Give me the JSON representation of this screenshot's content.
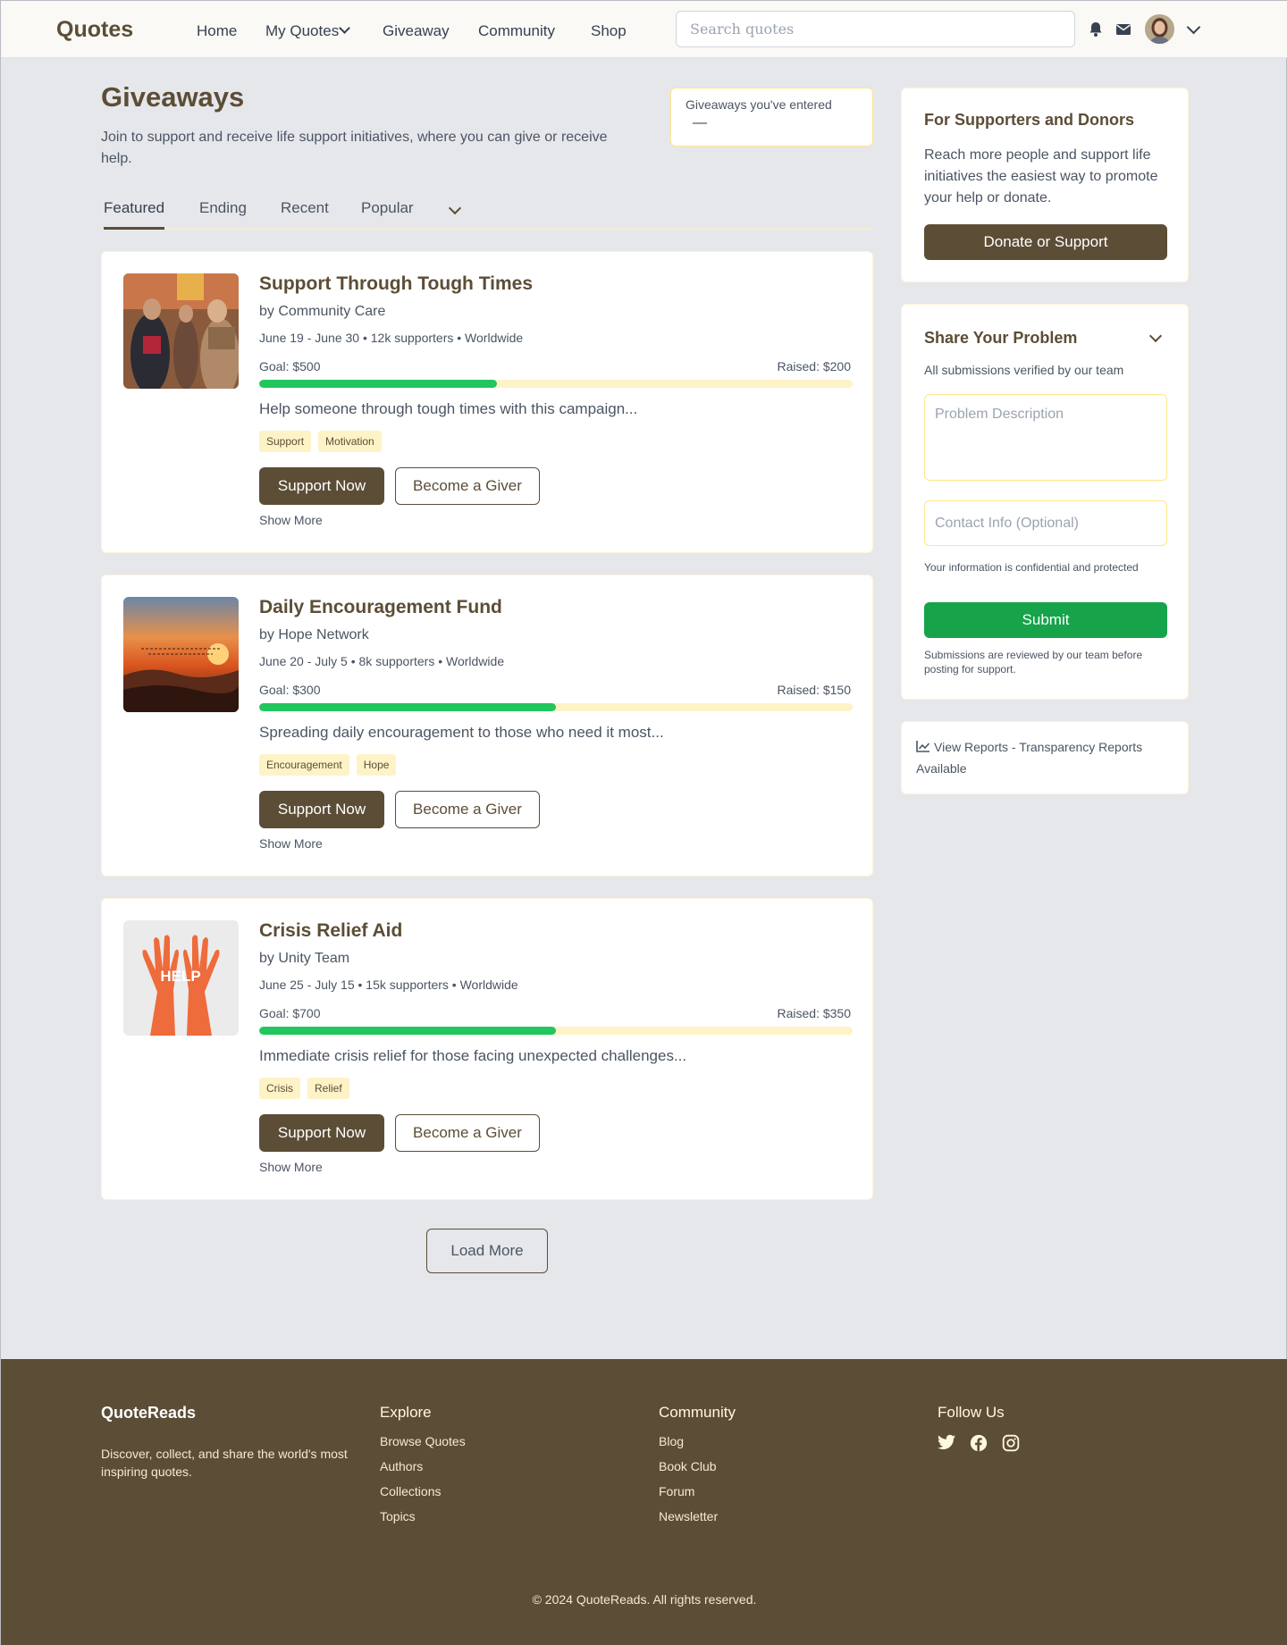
{
  "header": {
    "logo": "Quotes",
    "nav": [
      "Home",
      "My Quotes",
      "Giveaway",
      "Community",
      "Shop"
    ],
    "search_placeholder": "Search quotes"
  },
  "page": {
    "title": "Giveaways",
    "description": "Join to support and receive life support initiatives, where you can give or receive help.",
    "entered_label": "Giveaways you've entered",
    "entered_value": "—"
  },
  "tabs": [
    "Featured",
    "Ending",
    "Recent",
    "Popular"
  ],
  "cards": [
    {
      "title": "Support Through Tough Times",
      "by": "by Community Care",
      "meta": "June 19 - June 30 • 12k supporters • Worldwide",
      "goal": "Goal: $500",
      "raised": "Raised: $200",
      "progress": 0.4,
      "desc": "Help someone through tough times with this campaign...",
      "tags": [
        "Support",
        "Motivation"
      ],
      "support_label": "Support Now",
      "giver_label": "Become a Giver",
      "show_more": "Show More"
    },
    {
      "title": "Daily Encouragement Fund",
      "by": "by Hope Network",
      "meta": "June 20 - July 5 • 8k supporters • Worldwide",
      "goal": "Goal: $300",
      "raised": "Raised: $150",
      "progress": 0.5,
      "desc": "Spreading daily encouragement to those who need it most...",
      "tags": [
        "Encouragement",
        "Hope"
      ],
      "support_label": "Support Now",
      "giver_label": "Become a Giver",
      "show_more": "Show More"
    },
    {
      "title": "Crisis Relief Aid",
      "by": "by Unity Team",
      "meta": "June 25 - July 15 • 15k supporters • Worldwide",
      "goal": "Goal: $700",
      "raised": "Raised: $350",
      "progress": 0.5,
      "desc": "Immediate crisis relief for those facing unexpected challenges...",
      "tags": [
        "Crisis",
        "Relief"
      ],
      "support_label": "Support Now",
      "giver_label": "Become a Giver",
      "show_more": "Show More",
      "image_text": "HELP"
    }
  ],
  "load_more": "Load More",
  "sidebar": {
    "supporters": {
      "title": "For Supporters and Donors",
      "desc": "Reach more people and support life initiatives the easiest way to promote your help or donate.",
      "button": "Donate or Support"
    },
    "problem": {
      "title": "Share Your Problem",
      "subtitle": "All submissions verified by our team",
      "description_placeholder": "Problem Description",
      "contact_placeholder": "Contact Info (Optional)",
      "confidential": "Your information is confidential and protected",
      "submit": "Submit",
      "review_note": "Submissions are reviewed by our team before posting for support."
    },
    "reports": "View Reports - Transparency Reports Available"
  },
  "footer": {
    "brand": "QuoteReads",
    "brand_desc": "Discover, collect, and share the world's most inspiring quotes.",
    "explore_title": "Explore",
    "explore": [
      "Browse Quotes",
      "Authors",
      "Collections",
      "Topics"
    ],
    "community_title": "Community",
    "community": [
      "Blog",
      "Book Club",
      "Forum",
      "Newsletter"
    ],
    "follow_title": "Follow Us",
    "copyright": "© 2024 QuoteReads. All rights reserved."
  },
  "colors": {
    "brand": "#5c4d36",
    "success": "#16a34a",
    "progress": "#22c55e",
    "tag_bg": "#fef3c7"
  }
}
